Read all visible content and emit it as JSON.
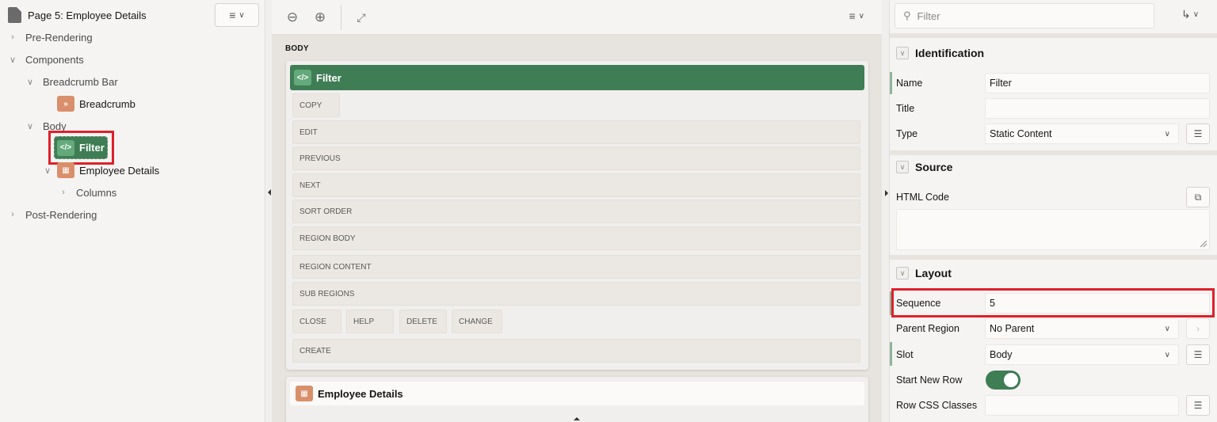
{
  "tree": {
    "page_title": "Page 5: Employee Details",
    "nodes": {
      "pre_rendering": "Pre-Rendering",
      "components": "Components",
      "breadcrumb_bar": "Breadcrumb Bar",
      "breadcrumb": "Breadcrumb",
      "body": "Body",
      "filter": "Filter",
      "employee_details": "Employee Details",
      "columns": "Columns",
      "post_rendering": "Post-Rendering"
    }
  },
  "canvas": {
    "body_label": "BODY",
    "filter_region": {
      "title": "Filter",
      "slots": [
        "COPY",
        "EDIT",
        "PREVIOUS",
        "NEXT",
        "SORT ORDER",
        "REGION BODY",
        "REGION CONTENT",
        "SUB REGIONS",
        "CLOSE",
        "HELP",
        "DELETE",
        "CHANGE",
        "CREATE"
      ]
    },
    "employee_region_title": "Employee Details"
  },
  "properties": {
    "filter_placeholder": "Filter",
    "groups": {
      "identification": "Identification",
      "source": "Source",
      "layout": "Layout"
    },
    "labels": {
      "name": "Name",
      "title": "Title",
      "type": "Type",
      "html_code": "HTML Code",
      "sequence": "Sequence",
      "parent_region": "Parent Region",
      "slot": "Slot",
      "start_new_row": "Start New Row",
      "row_css_classes": "Row CSS Classes"
    },
    "values": {
      "name": "Filter",
      "title": "",
      "type": "Static Content",
      "sequence": "5",
      "parent_region": "No Parent",
      "slot": "Body",
      "start_new_row": true,
      "row_css_classes": ""
    }
  },
  "colors": {
    "accent_green": "#3f7d54",
    "highlight_red": "#e0202a",
    "region_orange": "#d98f6b"
  }
}
